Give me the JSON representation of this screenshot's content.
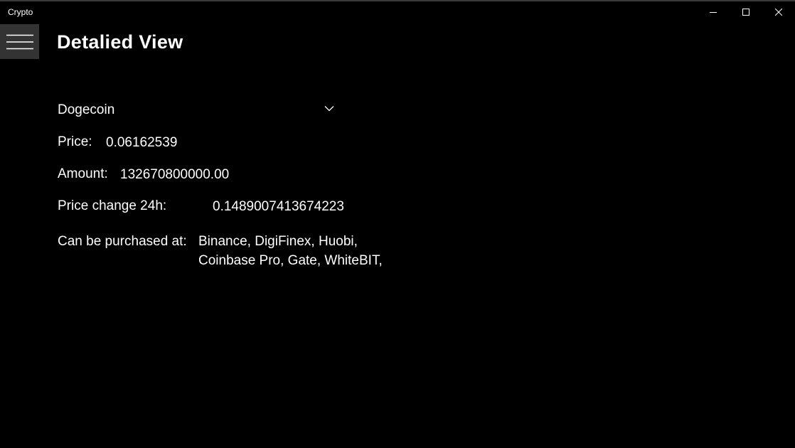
{
  "window": {
    "title": "Crypto",
    "minimize_icon": "minimize-icon",
    "maximize_icon": "maximize-icon",
    "close_icon": "close-icon"
  },
  "header": {
    "menu_icon": "hamburger-menu-icon",
    "title": "Detalied View"
  },
  "coin_selector": {
    "selected": "Dogecoin",
    "chevron_icon": "chevron-down-icon"
  },
  "details": {
    "price_label": "Price:",
    "price_value": "0.06162539",
    "amount_label": "Amount:",
    "amount_value": "132670800000.00",
    "change_label": "Price change 24h:",
    "change_value": "0.1489007413674223",
    "purchase_label": "Can be purchased at:",
    "purchase_lines": [
      "Binance, DigiFinex, Huobi,",
      "Coinbase Pro, Gate, WhiteBIT,"
    ]
  },
  "colors": {
    "background": "#000000",
    "text": "#ffffff",
    "hamburger_background": "#333333"
  }
}
